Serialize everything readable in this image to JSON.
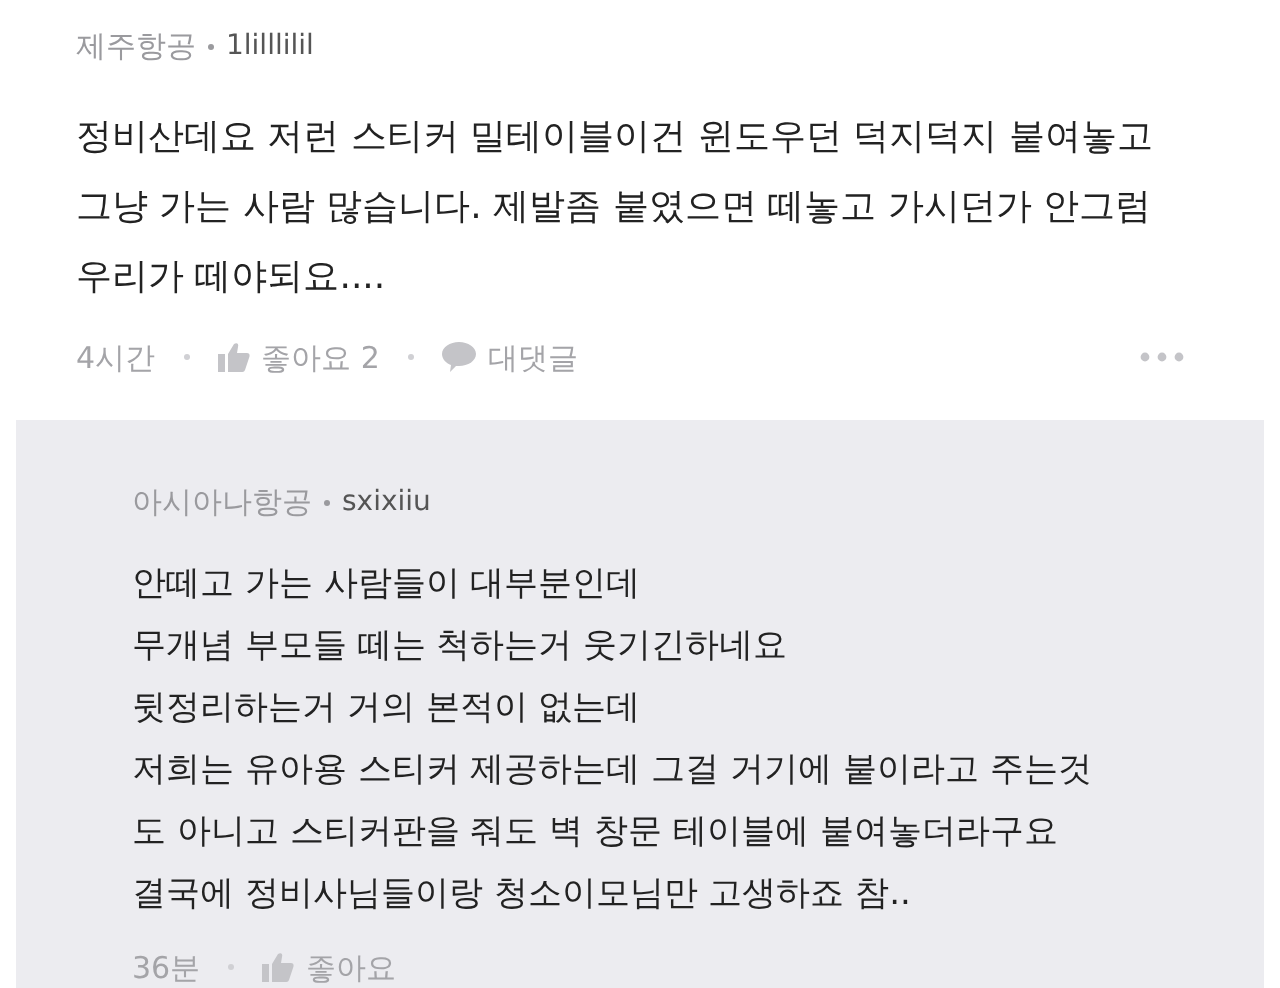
{
  "comment": {
    "airline": "제주항공",
    "user": "1lilllilil",
    "body": "정비산데요 저런 스티커 밀테이블이건 윈도우던 덕지덕지 붙여놓고\n그냥 가는 사람 많습니다. 제발좀 붙였으면 떼놓고 가시던가 안그럼\n우리가 떼야되요....",
    "time": "4시간",
    "like": "좋아요 2",
    "reply": "대댓글"
  },
  "reply": {
    "airline": "아시아나항공",
    "user": "sxixiiu",
    "body": "안떼고 가는 사람들이 대부분인데\n무개념 부모들 떼는 척하는거 웃기긴하네요\n뒷정리하는거 거의 본적이 없는데\n저희는 유아용 스티커 제공하는데 그걸 거기에 붙이라고 주는것\n도 아니고 스티커판을 줘도 벽 창문 테이블에 붙여놓더라구요\n결국에 정비사님들이랑 청소이모님만 고생하죠 참..",
    "time": "36분",
    "like": "좋아요"
  }
}
